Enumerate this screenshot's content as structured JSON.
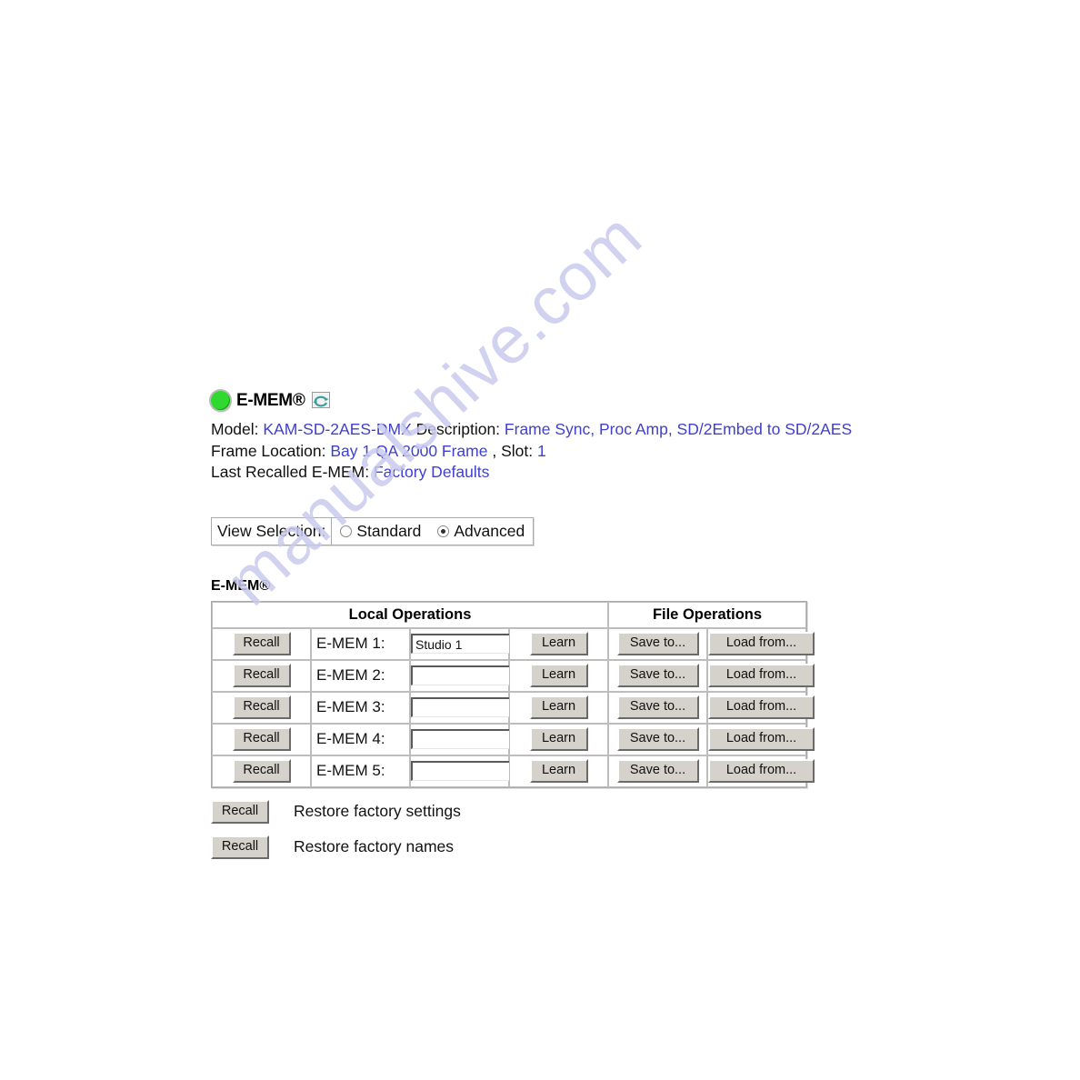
{
  "header": {
    "led_icon": "status-led-green",
    "led_color": "#2fd92f",
    "title": "E-MEM®",
    "refresh_icon": "refresh-icon",
    "refresh_color": "#3d9e9e"
  },
  "info": {
    "model_label": "Model:",
    "model_value": "KAM-SD-2AES-DMX",
    "description_label": "Description:",
    "description_value": "Frame Sync, Proc Amp, SD/2Embed to SD/2AES",
    "frame_location_label": "Frame Location:",
    "frame_location_value": "Bay 1 QA 2000 Frame",
    "slot_label": ", Slot:",
    "slot_value": "1",
    "last_recalled_label": "Last Recalled E-MEM:",
    "last_recalled_value": "Factory Defaults",
    "link_color": "#4040cc"
  },
  "view_selection": {
    "label": "View Selection:",
    "options": [
      {
        "label": "Standard",
        "selected": false
      },
      {
        "label": "Advanced",
        "selected": true
      }
    ]
  },
  "emem": {
    "section_heading": "E-MEM®",
    "columns": {
      "local_operations": "Local Operations",
      "file_operations": "File Operations"
    },
    "buttons": {
      "recall": "Recall",
      "learn": "Learn",
      "save_to": "Save to...",
      "load_from": "Load from..."
    },
    "rows": [
      {
        "label": "E-MEM 1:",
        "value": "Studio 1"
      },
      {
        "label": "E-MEM 2:",
        "value": ""
      },
      {
        "label": "E-MEM 3:",
        "value": ""
      },
      {
        "label": "E-MEM 4:",
        "value": ""
      },
      {
        "label": "E-MEM 5:",
        "value": ""
      }
    ]
  },
  "restore": [
    {
      "button": "Recall",
      "text": "Restore factory settings"
    },
    {
      "button": "Recall",
      "text": "Restore factory names"
    }
  ],
  "watermark": {
    "text": "manualshive.com",
    "color": "#c9c9ee"
  }
}
